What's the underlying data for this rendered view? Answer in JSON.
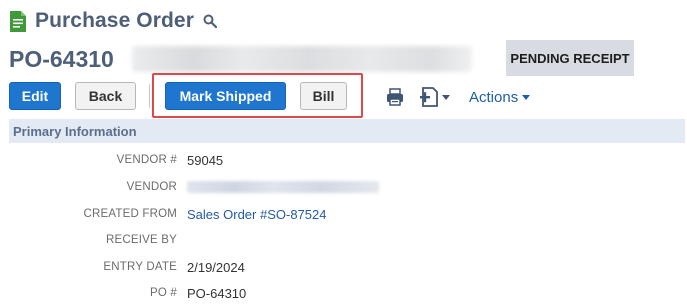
{
  "page": {
    "title": "Purchase Order",
    "record_number": "PO-64310",
    "status": "PENDING RECEIPT"
  },
  "icons": {
    "record_type": "document-icon",
    "search": "search-icon",
    "print": "print-icon",
    "new_document": "new-document-icon",
    "caret": "caret-down-icon"
  },
  "toolbar": {
    "edit_label": "Edit",
    "back_label": "Back",
    "mark_shipped_label": "Mark Shipped",
    "bill_label": "Bill",
    "actions_label": "Actions"
  },
  "section": {
    "title": "Primary Information"
  },
  "fields": [
    {
      "label": "VENDOR #",
      "value": "59045"
    },
    {
      "label": "VENDOR",
      "value": ""
    },
    {
      "label": "CREATED FROM",
      "value": "Sales Order #SO-87524"
    },
    {
      "label": "RECEIVE BY",
      "value": ""
    },
    {
      "label": "ENTRY DATE",
      "value": "2/19/2024"
    },
    {
      "label": "PO #",
      "value": "PO-64310"
    }
  ],
  "colors": {
    "title": "#4d5f79",
    "primary_button": "#1f76cf",
    "status_badge_bg": "#d8dbe2",
    "section_header_bg": "#e4eaf3",
    "link": "#255aa8",
    "highlight": "#e0474c",
    "record_icon": "#3f9a3a"
  }
}
